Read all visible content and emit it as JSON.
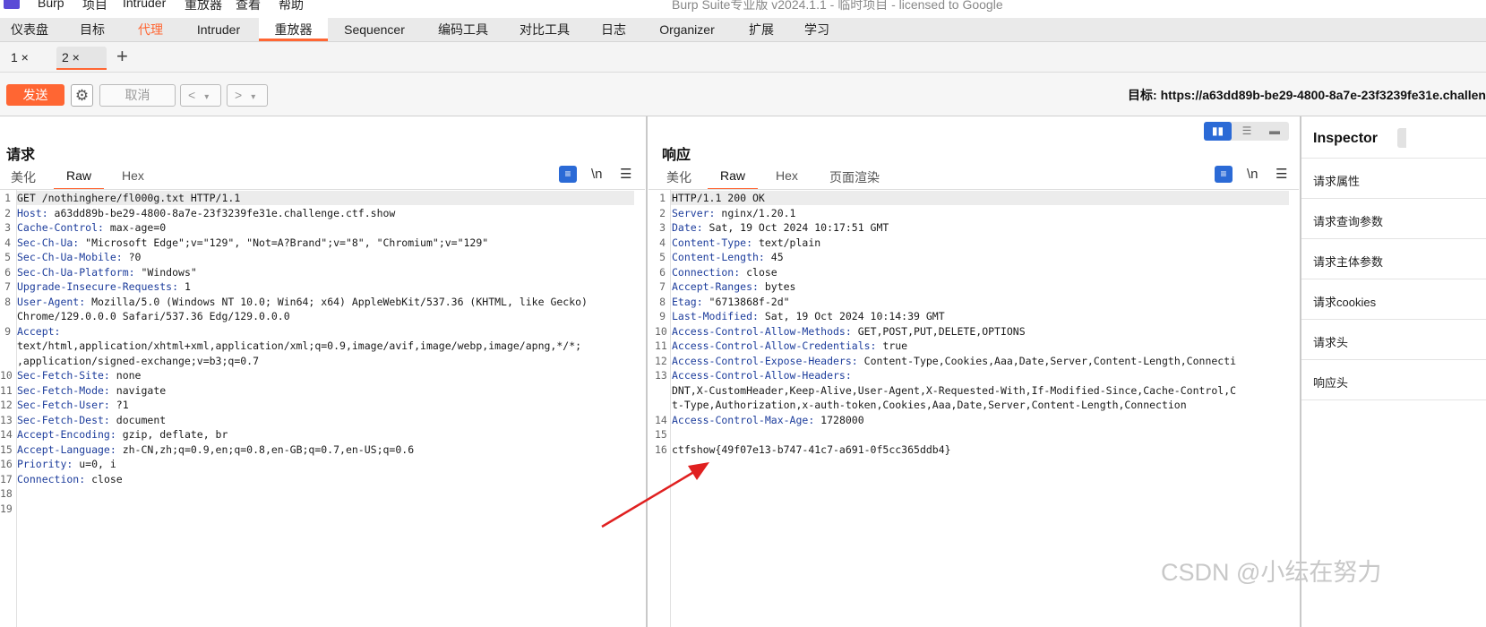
{
  "menubar": {
    "items": [
      "Burp",
      "项目",
      "Intruder",
      "重放器",
      "查看",
      "帮助"
    ],
    "window_title": "Burp Suite专业版  v2024.1.1 - 临时项目 - licensed to Google"
  },
  "main_tabs": [
    "仪表盘",
    "目标",
    "代理",
    "Intruder",
    "重放器",
    "Sequencer",
    "编码工具",
    "对比工具",
    "日志",
    "Organizer",
    "扩展",
    "学习"
  ],
  "repeater_tabs": [
    {
      "label": "1 ×"
    },
    {
      "label": "2 ×"
    }
  ],
  "toolbar": {
    "send_label": "发送",
    "cancel_label": "取消",
    "target_label": "目标: https://a63dd89b-be29-4800-8a7e-23f3239fe31e.challen"
  },
  "request": {
    "title": "请求",
    "view_tabs": [
      "美化",
      "Raw",
      "Hex"
    ],
    "lines": [
      {
        "n": "1",
        "key": "",
        "val": "GET /nothinghere/fl000g.txt HTTP/1.1"
      },
      {
        "n": "2",
        "key": "Host:",
        "val": " a63dd89b-be29-4800-8a7e-23f3239fe31e.challenge.ctf.show"
      },
      {
        "n": "3",
        "key": "Cache-Control:",
        "val": " max-age=0"
      },
      {
        "n": "4",
        "key": "Sec-Ch-Ua:",
        "val": " \"Microsoft Edge\";v=\"129\", \"Not=A?Brand\";v=\"8\", \"Chromium\";v=\"129\""
      },
      {
        "n": "5",
        "key": "Sec-Ch-Ua-Mobile:",
        "val": " ?0"
      },
      {
        "n": "6",
        "key": "Sec-Ch-Ua-Platform:",
        "val": " \"Windows\""
      },
      {
        "n": "7",
        "key": "Upgrade-Insecure-Requests:",
        "val": " 1"
      },
      {
        "n": "8",
        "key": "User-Agent:",
        "val": " Mozilla/5.0 (Windows NT 10.0; Win64; x64) AppleWebKit/537.36 (KHTML, like Gecko)"
      },
      {
        "n": "",
        "key": "",
        "val": "Chrome/129.0.0.0 Safari/537.36 Edg/129.0.0.0"
      },
      {
        "n": "9",
        "key": "Accept:",
        "val": ""
      },
      {
        "n": "",
        "key": "",
        "val": "text/html,application/xhtml+xml,application/xml;q=0.9,image/avif,image/webp,image/apng,*/*;"
      },
      {
        "n": "",
        "key": "",
        "val": ",application/signed-exchange;v=b3;q=0.7"
      },
      {
        "n": "10",
        "key": "Sec-Fetch-Site:",
        "val": " none"
      },
      {
        "n": "11",
        "key": "Sec-Fetch-Mode:",
        "val": " navigate"
      },
      {
        "n": "12",
        "key": "Sec-Fetch-User:",
        "val": " ?1"
      },
      {
        "n": "13",
        "key": "Sec-Fetch-Dest:",
        "val": " document"
      },
      {
        "n": "14",
        "key": "Accept-Encoding:",
        "val": " gzip, deflate, br"
      },
      {
        "n": "15",
        "key": "Accept-Language:",
        "val": " zh-CN,zh;q=0.9,en;q=0.8,en-GB;q=0.7,en-US;q=0.6"
      },
      {
        "n": "16",
        "key": "Priority:",
        "val": " u=0, i"
      },
      {
        "n": "17",
        "key": "Connection:",
        "val": " close"
      },
      {
        "n": "18",
        "key": "",
        "val": ""
      },
      {
        "n": "19",
        "key": "",
        "val": ""
      }
    ]
  },
  "response": {
    "title": "响应",
    "view_tabs": [
      "美化",
      "Raw",
      "Hex",
      "页面渲染"
    ],
    "lines": [
      {
        "n": "1",
        "key": "",
        "val": "HTTP/1.1 200 OK"
      },
      {
        "n": "2",
        "key": "Server:",
        "val": " nginx/1.20.1"
      },
      {
        "n": "3",
        "key": "Date:",
        "val": " Sat, 19 Oct 2024 10:17:51 GMT"
      },
      {
        "n": "4",
        "key": "Content-Type:",
        "val": " text/plain"
      },
      {
        "n": "5",
        "key": "Content-Length:",
        "val": " 45"
      },
      {
        "n": "6",
        "key": "Connection:",
        "val": " close"
      },
      {
        "n": "7",
        "key": "Accept-Ranges:",
        "val": " bytes"
      },
      {
        "n": "8",
        "key": "Etag:",
        "val": " \"6713868f-2d\""
      },
      {
        "n": "9",
        "key": "Last-Modified:",
        "val": " Sat, 19 Oct 2024 10:14:39 GMT"
      },
      {
        "n": "10",
        "key": "Access-Control-Allow-Methods:",
        "val": " GET,POST,PUT,DELETE,OPTIONS"
      },
      {
        "n": "11",
        "key": "Access-Control-Allow-Credentials:",
        "val": " true"
      },
      {
        "n": "12",
        "key": "Access-Control-Expose-Headers:",
        "val": " Content-Type,Cookies,Aaa,Date,Server,Content-Length,Connecti"
      },
      {
        "n": "13",
        "key": "Access-Control-Allow-Headers:",
        "val": ""
      },
      {
        "n": "",
        "key": "",
        "val": "DNT,X-CustomHeader,Keep-Alive,User-Agent,X-Requested-With,If-Modified-Since,Cache-Control,C"
      },
      {
        "n": "",
        "key": "",
        "val": "t-Type,Authorization,x-auth-token,Cookies,Aaa,Date,Server,Content-Length,Connection"
      },
      {
        "n": "14",
        "key": "Access-Control-Max-Age:",
        "val": " 1728000"
      },
      {
        "n": "15",
        "key": "",
        "val": ""
      },
      {
        "n": "16",
        "key": "",
        "val": "ctfshow{49f07e13-b747-41c7-a691-0f5cc365ddb4}"
      }
    ]
  },
  "inspector": {
    "title": "Inspector",
    "items": [
      "请求属性",
      "请求查询参数",
      "请求主体参数",
      "请求cookies",
      "请求头",
      "响应头"
    ]
  },
  "watermark": "CSDN @小纭在努力",
  "colors": {
    "accent": "#ff6633",
    "header_key": "#1d3d9c",
    "annotation_arrow": "#e02020"
  }
}
